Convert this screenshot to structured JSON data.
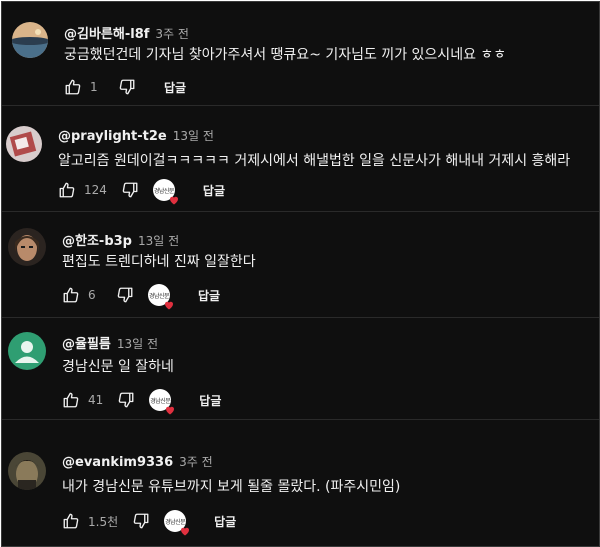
{
  "comments": [
    {
      "handle": "@김바른해-l8f",
      "time": "3주 전",
      "text": "궁금했던건데 기자님 찾아가주셔서 땡큐요~ 기자님도 끼가 있으시네요 ㅎㅎ",
      "likes": "1",
      "reply_label": "답글",
      "creator_heart": false,
      "avatar_color": "#8a7a6a"
    },
    {
      "handle": "@praylight-t2e",
      "time": "13일 전",
      "text": "알고리즘 원데이걸ㅋㅋㅋㅋㅋ 거제시에서 해낼법한 일을 신문사가 해내내 거제시 흥해라",
      "likes": "124",
      "reply_label": "답글",
      "creator_heart": true,
      "creator_badge_text": "경남신문",
      "avatar_color": "#b8a4a4"
    },
    {
      "handle": "@한조-b3p",
      "time": "13일 전",
      "text": "편집도 트렌디하네 진짜 일잘한다",
      "likes": "6",
      "reply_label": "답글",
      "creator_heart": true,
      "creator_badge_text": "경남신문",
      "avatar_color": "#6b5a4e"
    },
    {
      "handle": "@율필름",
      "time": "13일 전",
      "text": "경남신문 일 잘하네",
      "likes": "41",
      "reply_label": "답글",
      "creator_heart": true,
      "creator_badge_text": "경남신문",
      "avatar_color": "#2f9e72"
    },
    {
      "handle": "@evankim9336",
      "time": "3주 전",
      "text": "내가 경남신문 유튜브까지 보게 될줄 몰랐다. (파주시민임)",
      "likes": "1.5천",
      "reply_label": "답글",
      "creator_heart": true,
      "creator_badge_text": "경남신문",
      "avatar_color": "#3a3a2e"
    }
  ],
  "colors": {
    "background": "#0f0f0f",
    "text": "#f1f1f1",
    "muted": "#aaaaaa",
    "heart": "#e0303f"
  },
  "icons": [
    "thumbs-up-icon",
    "thumbs-down-icon",
    "heart-icon",
    "avatar-default-icon"
  ]
}
